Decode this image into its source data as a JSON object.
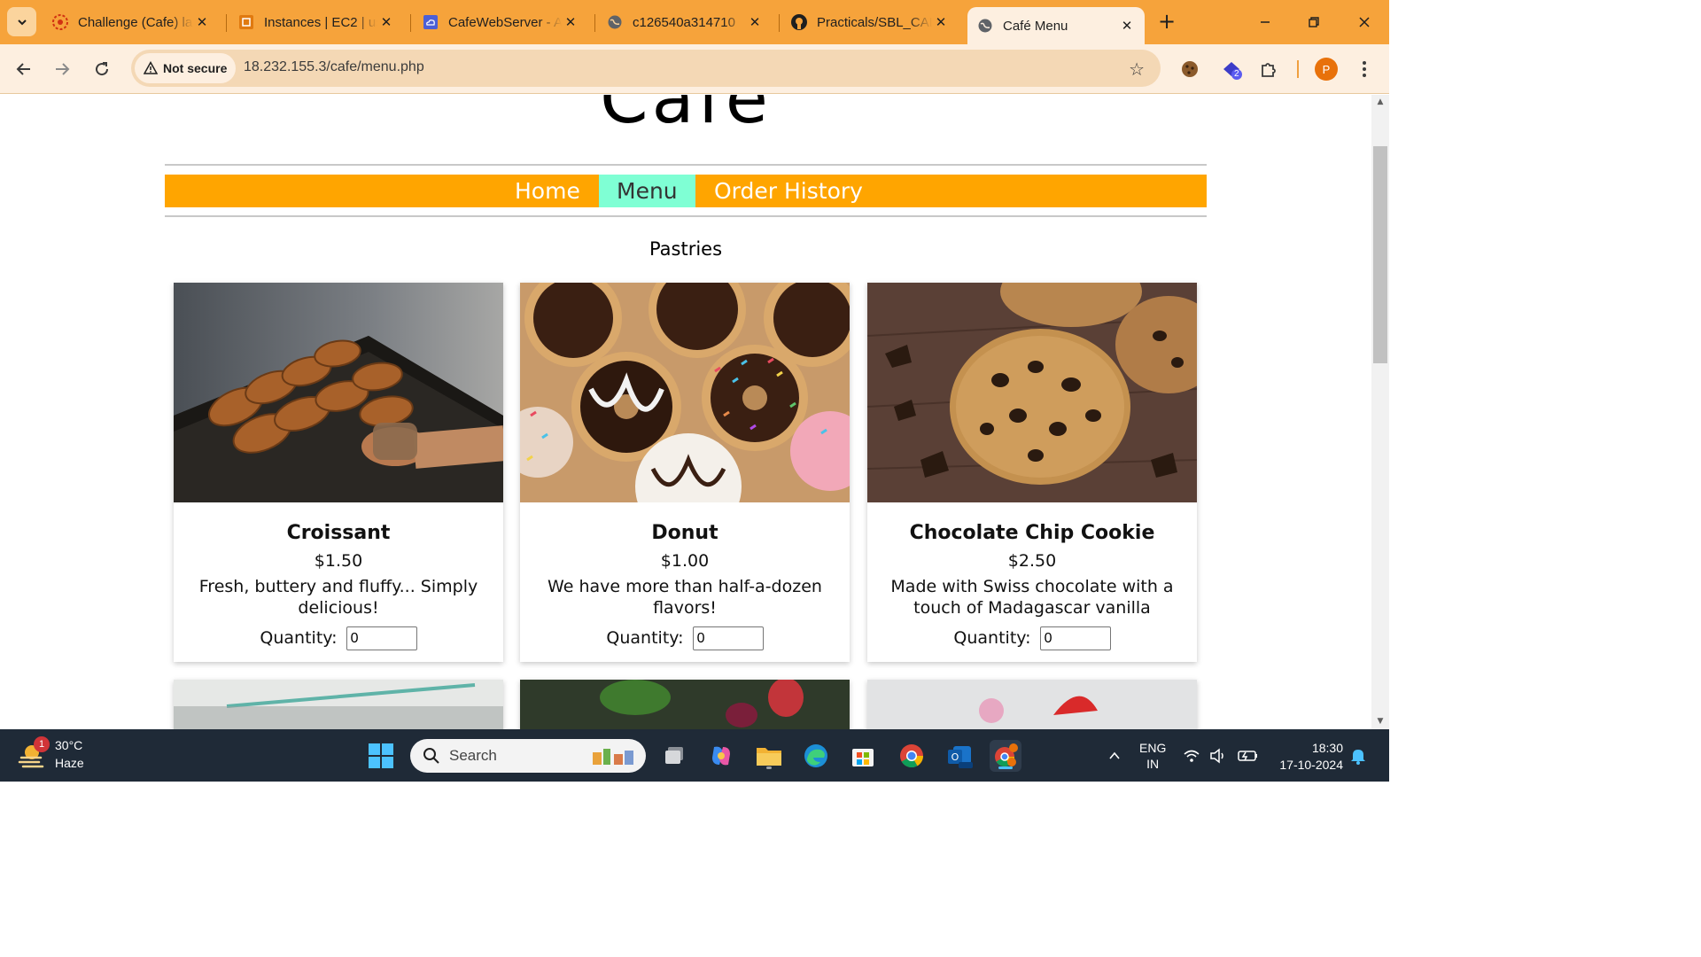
{
  "browser": {
    "tabs": [
      {
        "title": "Challenge (Cafe) la",
        "favicon": "aws-academy-icon",
        "active": false
      },
      {
        "title": "Instances | EC2 | us",
        "favicon": "ec2-icon",
        "active": false
      },
      {
        "title": "CafeWebServer - A",
        "favicon": "cloud-icon",
        "active": false
      },
      {
        "title": "c126540a314710",
        "favicon": "globe-icon",
        "active": false
      },
      {
        "title": "Practicals/SBL_CAL",
        "favicon": "github-icon",
        "active": false
      },
      {
        "title": "Café Menu",
        "favicon": "globe-icon",
        "active": true
      }
    ],
    "security_label": "Not secure",
    "url": "18.232.155.3/cafe/menu.php",
    "profile_initial": "P",
    "extension_badge": "2"
  },
  "page": {
    "site_title": "Café",
    "nav": [
      {
        "label": "Home",
        "active": false
      },
      {
        "label": "Menu",
        "active": true
      },
      {
        "label": "Order History",
        "active": false
      }
    ],
    "section_heading": "Pastries",
    "quantity_label": "Quantity:",
    "products": [
      {
        "name": "Croissant",
        "price": "$1.50",
        "description": "Fresh, buttery and fluffy... Simply delicious!",
        "quantity": "0"
      },
      {
        "name": "Donut",
        "price": "$1.00",
        "description": "We have more than half-a-dozen flavors!",
        "quantity": "0"
      },
      {
        "name": "Chocolate Chip Cookie",
        "price": "$2.50",
        "description": "Made with Swiss chocolate with a touch of Madagascar vanilla",
        "quantity": "0"
      }
    ]
  },
  "taskbar": {
    "weather_temp": "30°C",
    "weather_desc": "Haze",
    "weather_badge": "1",
    "search_placeholder": "Search",
    "language": "ENG",
    "region": "IN",
    "time": "18:30",
    "date": "17-10-2024"
  },
  "colors": {
    "tabstrip": "#f6a33b",
    "toolbar": "#fdefe0",
    "navbar": "#ffa500",
    "nav_active": "#7fffd4",
    "taskbar": "#1f2a37"
  }
}
